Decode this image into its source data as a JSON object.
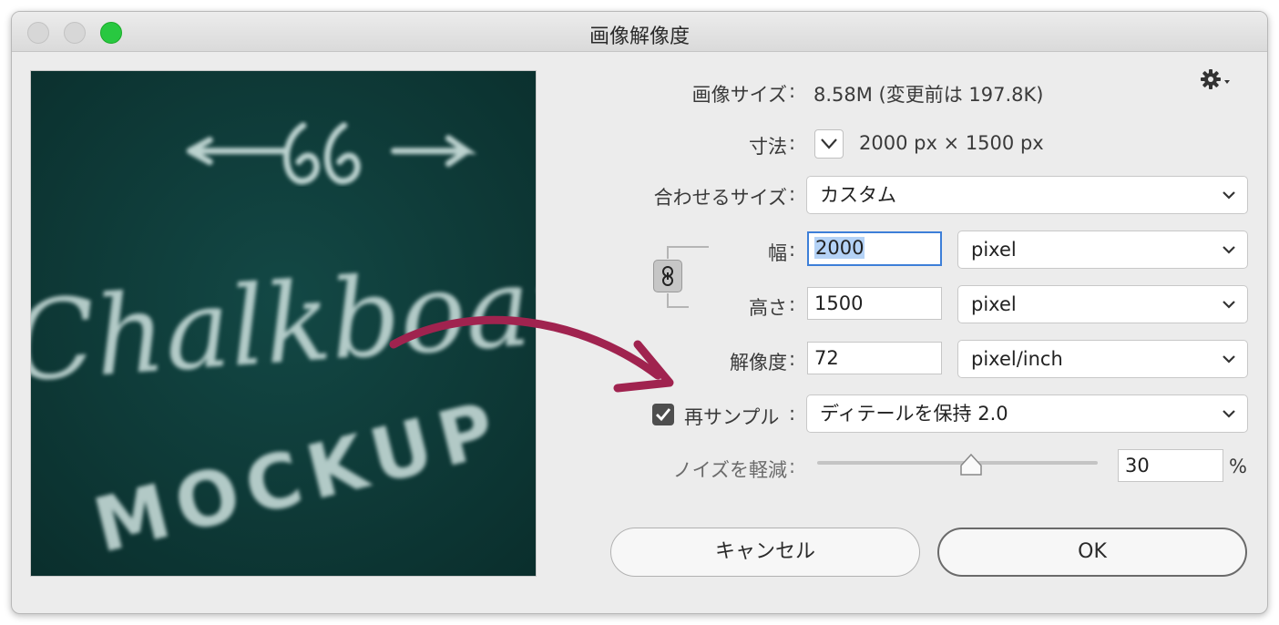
{
  "window": {
    "title": "画像解像度"
  },
  "info": {
    "image_size_label": "画像サイズ",
    "image_size_value": "8.58M (変更前は 197.8K)",
    "dimensions_label": "寸法",
    "dimensions_value": "2000 px × 1500 px"
  },
  "fit_to": {
    "label": "合わせるサイズ",
    "value": "カスタム"
  },
  "width": {
    "label": "幅",
    "value": "2000",
    "unit": "pixel"
  },
  "height": {
    "label": "高さ",
    "value": "1500",
    "unit": "pixel"
  },
  "resolution": {
    "label": "解像度",
    "value": "72",
    "unit": "pixel/inch"
  },
  "resample": {
    "label": "再サンプル",
    "checked": true,
    "method": "ディテールを保持 2.0"
  },
  "noise": {
    "label": "ノイズを軽減",
    "value": "30",
    "unit": "%",
    "level": 0.55
  },
  "preview_text": {
    "line1": "Chalkboard",
    "line2": "MOCKUP"
  },
  "buttons": {
    "cancel": "キャンセル",
    "ok": "OK"
  },
  "colors": {
    "accent": "#3d7fd8",
    "arrow": "#a0234f",
    "preview_bg": "#0e3a38",
    "chalk": "#cfe3e0"
  },
  "colon": ":"
}
